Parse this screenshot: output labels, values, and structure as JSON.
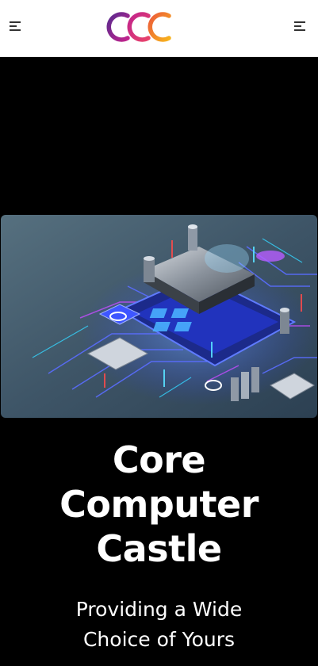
{
  "header": {
    "logo_text": "CCC",
    "colors": {
      "logo_purple": "#6a2c91",
      "logo_magenta": "#d3208b",
      "logo_orange": "#f5a11a",
      "background": "#ffffff"
    },
    "left_menu_icon": "menu-icon",
    "right_menu_icon": "menu-icon"
  },
  "hero": {
    "title_lines": [
      "Core",
      "Computer",
      "Castle"
    ],
    "subtitle_lines": [
      "Providing a Wide",
      "Choice of Yours"
    ],
    "image_icon": "circuit-board-chip-illustration",
    "colors": {
      "page_background": "#000000",
      "text": "#ffffff"
    }
  }
}
